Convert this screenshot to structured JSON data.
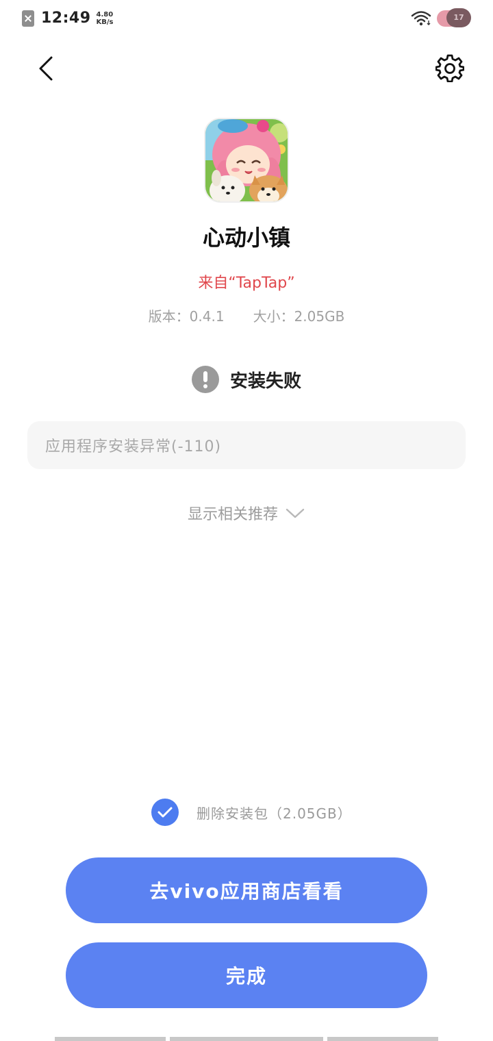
{
  "status_bar": {
    "time": "12:49",
    "net_speed_value": "4.80",
    "net_speed_unit": "KB/s",
    "battery_level": "17"
  },
  "nav": {
    "back_icon": "chevron-left-icon",
    "settings_icon": "gear-icon"
  },
  "app": {
    "name": "心动小镇",
    "source": "来自“TapTap”",
    "version": "版本：0.4.1",
    "size": "大小：2.05GB"
  },
  "install": {
    "status_text": "安装失败",
    "error_message": "应用程序安装异常(-110)",
    "recommend_label": "显示相关推荐"
  },
  "delete_package": {
    "checked": true,
    "label": "删除安装包（2.05GB）"
  },
  "buttons": {
    "store": "去vivo应用商店看看",
    "done": "完成"
  },
  "colors": {
    "accent": "#5b82f2",
    "source_red": "#e0474c",
    "checkbox_blue": "#4d7cf0"
  }
}
